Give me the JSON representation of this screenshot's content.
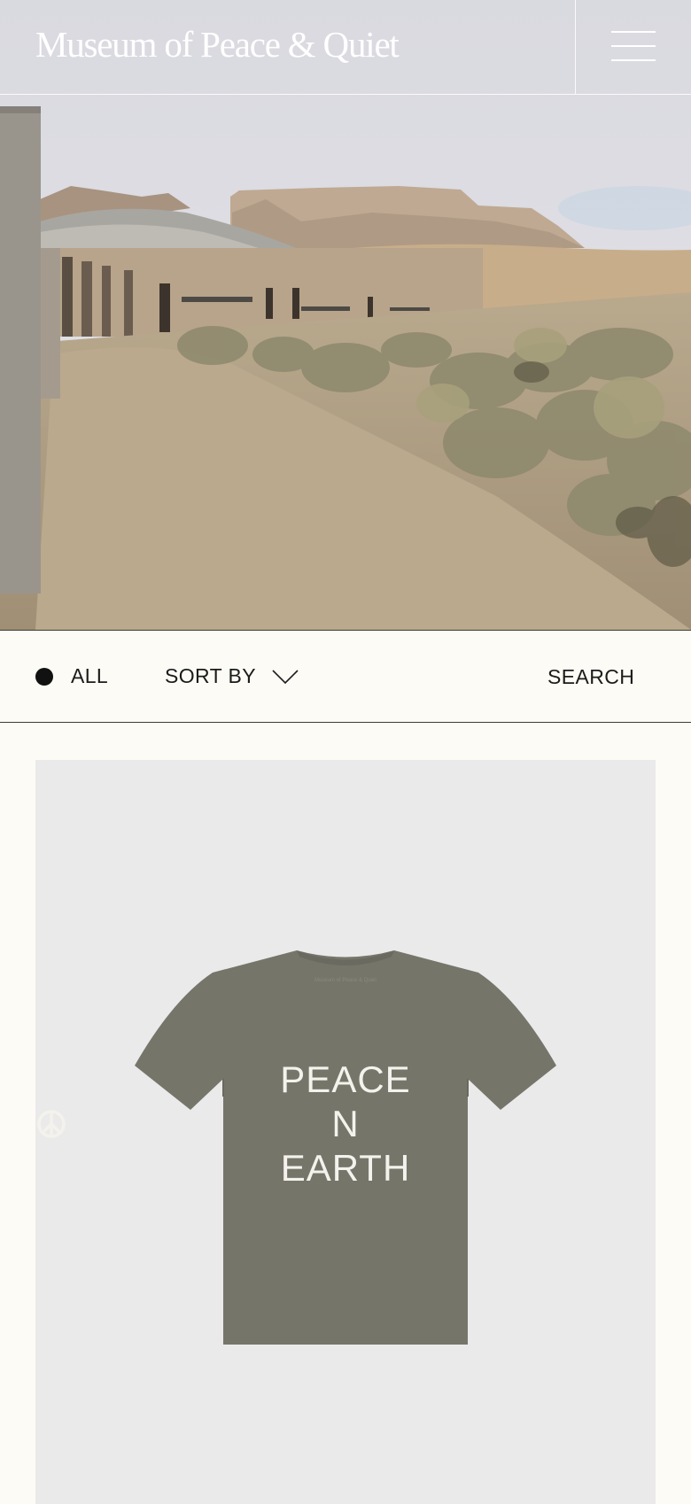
{
  "header": {
    "logo_text": "Museum of Peace & Quiet",
    "menu_icon": "hamburger-menu-icon"
  },
  "hero": {
    "image_description_icon": "desert-landscape-image"
  },
  "filter_bar": {
    "all_label": "ALL",
    "sort_label": "SORT BY",
    "search_label": "SEARCH"
  },
  "product": {
    "print_line1": "PEACE",
    "print_line2": "N",
    "print_line3": "EARTH",
    "shirt_color": "#76756a",
    "card_background": "#eaeaea"
  },
  "colors": {
    "page_background": "#fcfbf5",
    "text": "#1b1b1b",
    "divider": "#3b3b33"
  }
}
